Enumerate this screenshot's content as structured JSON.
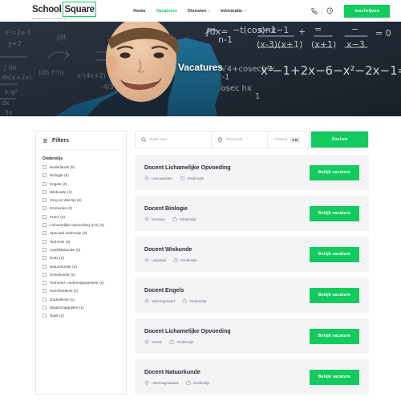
{
  "brand": {
    "logo_school": "School",
    "logo_square": "Square",
    "tagline": "De juiste docent, op de juiste plek",
    "accent_color": "#13ca5e"
  },
  "header": {
    "nav": [
      {
        "label": "Home",
        "active": false,
        "dropdown": false
      },
      {
        "label": "Vacatures",
        "active": true,
        "dropdown": false
      },
      {
        "label": "Diensten",
        "active": false,
        "dropdown": true
      },
      {
        "label": "Informatie",
        "active": false,
        "dropdown": true
      }
    ],
    "phone_icon": "phone-icon",
    "clock_icon": "clock-icon",
    "cta_label": "Inschrijven"
  },
  "hero": {
    "title": "Vacatures"
  },
  "sidebar": {
    "filters_title": "Filters",
    "groups": [
      {
        "title": "Onderwijs",
        "items": [
          {
            "label": "Nederlands (9)",
            "checked": false
          },
          {
            "label": "Biologie (5)",
            "checked": false
          },
          {
            "label": "Engels (4)",
            "checked": false
          },
          {
            "label": "Wiskunde (4)",
            "checked": false
          },
          {
            "label": "Zorg en Welzijn (4)",
            "checked": false
          },
          {
            "label": "Economie (3)",
            "checked": false
          },
          {
            "label": "Frans (3)",
            "checked": false
          },
          {
            "label": "Lichamelijke Opvoeding (LO) (3)",
            "checked": false
          },
          {
            "label": "Speciaal onderwijs (3)",
            "checked": false
          },
          {
            "label": "Techniek (3)",
            "checked": false
          },
          {
            "label": "Aardrijkskunde (2)",
            "checked": false
          },
          {
            "label": "Duits (2)",
            "checked": false
          },
          {
            "label": "Natuurkunde (2)",
            "checked": false
          },
          {
            "label": "Scheikunde (2)",
            "checked": false
          },
          {
            "label": "Technisch onderwijsassistent (2)",
            "checked": false
          },
          {
            "label": "Geschiedenis (1)",
            "checked": false
          },
          {
            "label": "Godsdienst (1)",
            "checked": false
          },
          {
            "label": "Maatschappijleer (1)",
            "checked": false
          },
          {
            "label": "Nask (1)",
            "checked": false
          }
        ]
      }
    ]
  },
  "search": {
    "keyword_placeholder": "Zoek naar",
    "keyword_value": "",
    "postcode_placeholder": "Postcode",
    "postcode_value": "",
    "distance_label": "Afstand",
    "distance_unit": "KM",
    "submit_label": "Zoeken"
  },
  "jobs": {
    "action_label": "Bekijk vacature",
    "items": [
      {
        "title": "Docent Lichamelijke Opvoeding",
        "location": "Leeuwarden",
        "sector": "Onderwijs"
      },
      {
        "title": "Docent Biologie",
        "location": "Dronten",
        "sector": "Onderwijs"
      },
      {
        "title": "Docent Wiskunde",
        "location": "Lelystad",
        "sector": "Onderwijs"
      },
      {
        "title": "Docent Engels",
        "location": "Wieringerwerf",
        "sector": "Onderwijs"
      },
      {
        "title": "Docent Lichamelijke Opvoeding",
        "location": "Sneek",
        "sector": "Onderwijs"
      },
      {
        "title": "Docent Natuurkunde",
        "location": "Heerhugowaard",
        "sector": "Onderwijs"
      }
    ]
  }
}
